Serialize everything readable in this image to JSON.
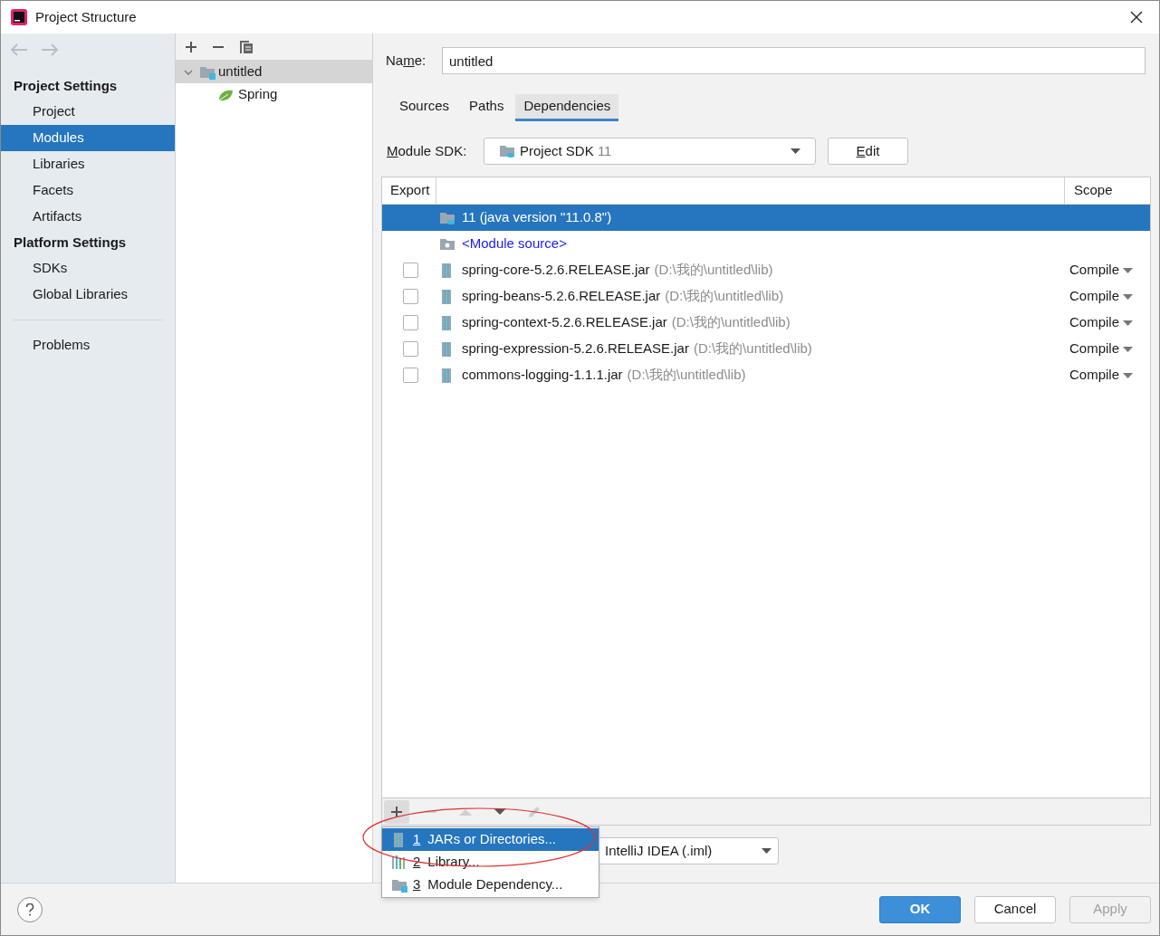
{
  "window": {
    "title": "Project Structure"
  },
  "sidebar": {
    "sections": [
      {
        "heading": "Project Settings",
        "items": [
          {
            "label": "Project",
            "selected": false
          },
          {
            "label": "Modules",
            "selected": true
          },
          {
            "label": "Libraries",
            "selected": false
          },
          {
            "label": "Facets",
            "selected": false
          },
          {
            "label": "Artifacts",
            "selected": false
          }
        ]
      },
      {
        "heading": "Platform Settings",
        "items": [
          {
            "label": "SDKs",
            "selected": false
          },
          {
            "label": "Global Libraries",
            "selected": false
          }
        ]
      }
    ],
    "extra_items": [
      {
        "label": "Problems",
        "selected": false
      }
    ]
  },
  "module_tree": {
    "items": [
      {
        "label": "untitled",
        "expanded": true,
        "selected": true,
        "children": [
          {
            "label": "Spring",
            "selected": false
          }
        ]
      }
    ]
  },
  "name_field": {
    "label": {
      "before": "Na",
      "key": "m",
      "after": "e:"
    },
    "value": "untitled"
  },
  "tabs": [
    {
      "label": "Sources",
      "selected": false
    },
    {
      "label": "Paths",
      "selected": false
    },
    {
      "label": "Dependencies",
      "selected": true
    }
  ],
  "module_sdk": {
    "label": {
      "key": "M",
      "after": "odule SDK:"
    },
    "name": "Project SDK",
    "version": "11",
    "edit_button": {
      "label": {
        "key": "E",
        "after": "dit"
      }
    }
  },
  "table": {
    "columns": [
      "Export",
      "Scope"
    ],
    "rows": [
      {
        "kind": "sdk",
        "name": "11 (java version \"11.0.8\")",
        "selected": true
      },
      {
        "kind": "source",
        "name": "<Module source>",
        "selected": false
      },
      {
        "kind": "jar",
        "checked": false,
        "name": "spring-core-5.2.6.RELEASE.jar",
        "path": "(D:\\我的\\untitled\\lib)",
        "scope": "Compile",
        "selected": false
      },
      {
        "kind": "jar",
        "checked": false,
        "name": "spring-beans-5.2.6.RELEASE.jar",
        "path": "(D:\\我的\\untitled\\lib)",
        "scope": "Compile",
        "selected": false
      },
      {
        "kind": "jar",
        "checked": false,
        "name": "spring-context-5.2.6.RELEASE.jar",
        "path": "(D:\\我的\\untitled\\lib)",
        "scope": "Compile",
        "selected": false
      },
      {
        "kind": "jar",
        "checked": false,
        "name": "spring-expression-5.2.6.RELEASE.jar",
        "path": "(D:\\我的\\untitled\\lib)",
        "scope": "Compile",
        "selected": false
      },
      {
        "kind": "jar",
        "checked": false,
        "name": "commons-logging-1.1.1.jar",
        "path": "(D:\\我的\\untitled\\lib)",
        "scope": "Compile",
        "selected": false
      }
    ]
  },
  "table_toolbar": [
    {
      "kind": "add",
      "disabled": false
    },
    {
      "kind": "remove",
      "disabled": true
    },
    {
      "kind": "up",
      "disabled": true
    },
    {
      "kind": "down",
      "disabled": false
    },
    {
      "kind": "edit",
      "disabled": true
    }
  ],
  "popup_menu": {
    "items": [
      {
        "kind": "jar",
        "key": "1",
        "label": "JARs or Directories...",
        "selected": true
      },
      {
        "kind": "library",
        "key": "2",
        "label": "Library...",
        "selected": false
      },
      {
        "kind": "module",
        "key": "3",
        "label": "Module Dependency...",
        "selected": false
      }
    ]
  },
  "storage_format": {
    "value": "IntelliJ IDEA (.iml)"
  },
  "buttons": [
    {
      "label": "OK",
      "primary": true,
      "disabled": false
    },
    {
      "label": "Cancel",
      "primary": false,
      "disabled": false
    },
    {
      "label": "Apply",
      "primary": false,
      "disabled": true
    }
  ]
}
